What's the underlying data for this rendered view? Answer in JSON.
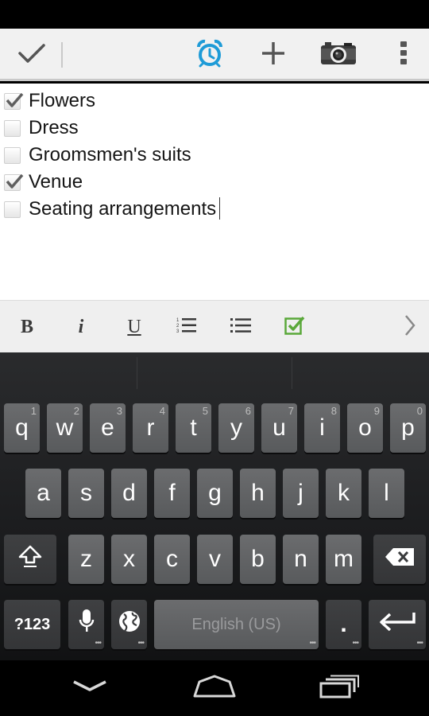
{
  "checklist": {
    "items": [
      {
        "label": "Flowers",
        "checked": true
      },
      {
        "label": "Dress",
        "checked": false
      },
      {
        "label": "Groomsmen's suits",
        "checked": false
      },
      {
        "label": "Venue",
        "checked": true
      },
      {
        "label": "Seating arrangements",
        "checked": false
      }
    ]
  },
  "format_bar": {
    "bold": "B",
    "italic": "i",
    "underline": "U"
  },
  "keyboard": {
    "row1": [
      {
        "key": "q",
        "hint": "1"
      },
      {
        "key": "w",
        "hint": "2"
      },
      {
        "key": "e",
        "hint": "3"
      },
      {
        "key": "r",
        "hint": "4"
      },
      {
        "key": "t",
        "hint": "5"
      },
      {
        "key": "y",
        "hint": "6"
      },
      {
        "key": "u",
        "hint": "7"
      },
      {
        "key": "i",
        "hint": "8"
      },
      {
        "key": "o",
        "hint": "9"
      },
      {
        "key": "p",
        "hint": "0"
      }
    ],
    "row2": [
      "a",
      "s",
      "d",
      "f",
      "g",
      "h",
      "j",
      "k",
      "l"
    ],
    "row3": [
      "z",
      "x",
      "c",
      "v",
      "b",
      "n",
      "m"
    ],
    "symbols_label": "?123",
    "space_label": "English (US)",
    "period_label": "."
  },
  "colors": {
    "accent_blue": "#1e9bd7",
    "check_green": "#5aa83a",
    "key_gray": "#626365"
  },
  "icons": {
    "action_bar": [
      "checkmark-icon",
      "alarm-clock-icon",
      "plus-icon",
      "camera-icon",
      "overflow-menu-icon"
    ],
    "format_bar": [
      "bold-icon",
      "italic-icon",
      "underline-icon",
      "numbered-list-icon",
      "bulleted-list-icon",
      "checkbox-icon",
      "chevron-right-icon"
    ],
    "nav_bar": [
      "back-icon",
      "home-icon",
      "recent-apps-icon"
    ]
  }
}
